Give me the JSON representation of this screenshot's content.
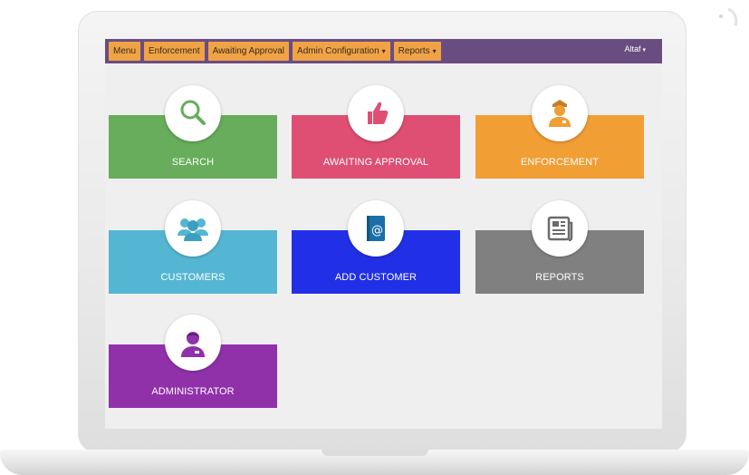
{
  "navbar": {
    "items": [
      {
        "label": "Menu",
        "dropdown": false
      },
      {
        "label": "Enforcement",
        "dropdown": false
      },
      {
        "label": "Awaiting Approval",
        "dropdown": false
      },
      {
        "label": "Admin Configuration",
        "dropdown": true
      },
      {
        "label": "Reports",
        "dropdown": true
      }
    ],
    "user": "Altaf",
    "bar_color": "#6a4d80",
    "button_color": "#f0a346"
  },
  "tiles": [
    {
      "label": "SEARCH",
      "icon": "search-icon",
      "color": "#67ad5b"
    },
    {
      "label": "AWAITING APPROVAL",
      "icon": "thumbs-up-icon",
      "color": "#de4f73"
    },
    {
      "label": "ENFORCEMENT",
      "icon": "officer-icon",
      "color": "#f19e35"
    },
    {
      "label": "CUSTOMERS",
      "icon": "group-icon",
      "color": "#55b6d3"
    },
    {
      "label": "ADD CUSTOMER",
      "icon": "address-book-icon",
      "color": "#2130e6"
    },
    {
      "label": "REPORTS",
      "icon": "newspaper-icon",
      "color": "#808080"
    },
    {
      "label": "ADMINISTRATOR",
      "icon": "admin-user-icon",
      "color": "#9031aa"
    }
  ]
}
